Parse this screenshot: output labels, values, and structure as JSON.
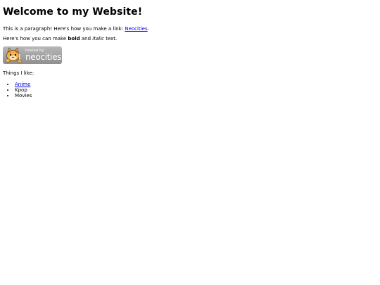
{
  "page": {
    "heading": "Welcome to my Website!",
    "paragraph1": {
      "text_before_link": "This is a paragraph! Here's how you make a link: ",
      "link_text": "Neocities",
      "text_after_link": "."
    },
    "paragraph2": {
      "text_before_bold": "Here's how you can make ",
      "bold_text": "bold",
      "text_between": " and ",
      "italic_text": "italic",
      "text_after_italic": " text."
    },
    "badge": {
      "small_text": "hosted by",
      "big_text": "neocities"
    },
    "things_label": "Things I like:",
    "things": [
      {
        "label": "Anime",
        "is_link": true
      },
      {
        "label": "Kpop",
        "is_link": false
      },
      {
        "label": "Movies",
        "is_link": false
      }
    ]
  },
  "colors": {
    "link": "#0000ee",
    "text": "#000000",
    "background": "#ffffff",
    "badge_background": "#a6a6a6"
  },
  "icons": {
    "badge_mascot": "cat-mascot-icon"
  }
}
